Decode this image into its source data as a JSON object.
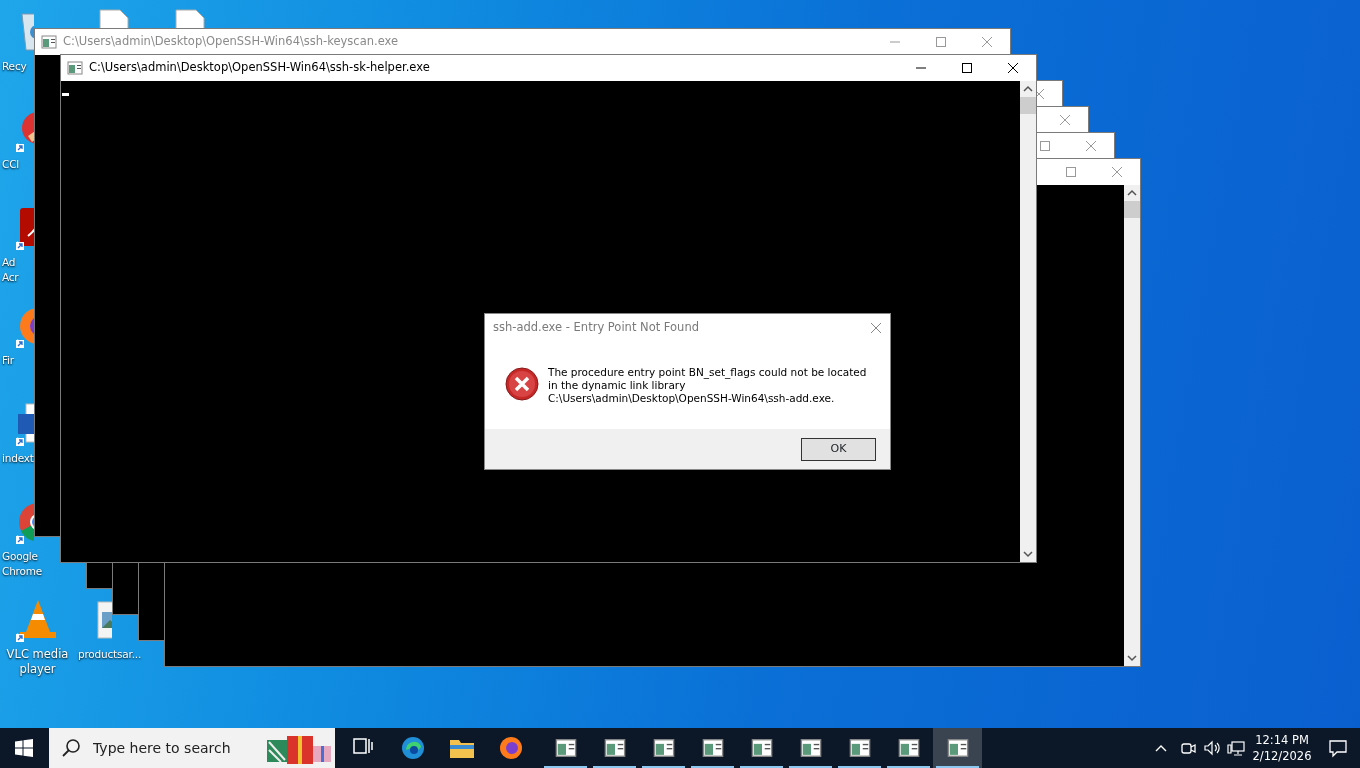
{
  "desktop_icons": [
    {
      "kind": "recycle",
      "label": "Recy"
    },
    {
      "kind": "worddoc"
    },
    {
      "kind": "worddoc"
    },
    {
      "kind": "ccleaner",
      "label": "CCl"
    },
    {
      "kind": "acrobat",
      "label": "Ad\nAcr"
    },
    {
      "kind": "firefox",
      "label": "Fir"
    },
    {
      "kind": "word",
      "label": "indext"
    },
    {
      "kind": "chrome",
      "label": "Google\nChrome"
    },
    {
      "kind": "vlc",
      "label": "VLC media\nplayer"
    },
    {
      "kind": "image",
      "label": "productsar..."
    }
  ],
  "windows": [
    {
      "title": "C:\\Users\\admin\\Desktop\\OpenSSH-Win64\\ssh-keyscan.exe",
      "active": false
    },
    {
      "title": "C:\\Users\\admin\\Desktop\\OpenSSH-Win64\\ssh-sk-helper.exe",
      "active": true
    },
    {
      "active": false
    },
    {
      "active": false
    },
    {
      "active": false
    },
    {
      "active": false
    }
  ],
  "dialog": {
    "title": "ssh-add.exe - Entry Point Not Found",
    "message": "The procedure entry point BN_set_flags could not be located\nin the dynamic link library\nC:\\Users\\admin\\Desktop\\OpenSSH-Win64\\ssh-add.exe.",
    "button": "OK"
  },
  "taskbar": {
    "search": {
      "placeholder": "Type here to search"
    },
    "pinned": [
      {
        "kind": "taskview"
      },
      {
        "kind": "edge"
      },
      {
        "kind": "explorer"
      },
      {
        "kind": "firefox"
      }
    ],
    "apps": [
      {
        "selected": false
      },
      {
        "selected": false
      },
      {
        "selected": false
      },
      {
        "selected": false
      },
      {
        "selected": false
      },
      {
        "selected": false
      },
      {
        "selected": false
      },
      {
        "selected": false
      },
      {
        "selected": true
      }
    ],
    "clock": {
      "time": "12:14 PM",
      "date": "2/12/2026"
    }
  }
}
